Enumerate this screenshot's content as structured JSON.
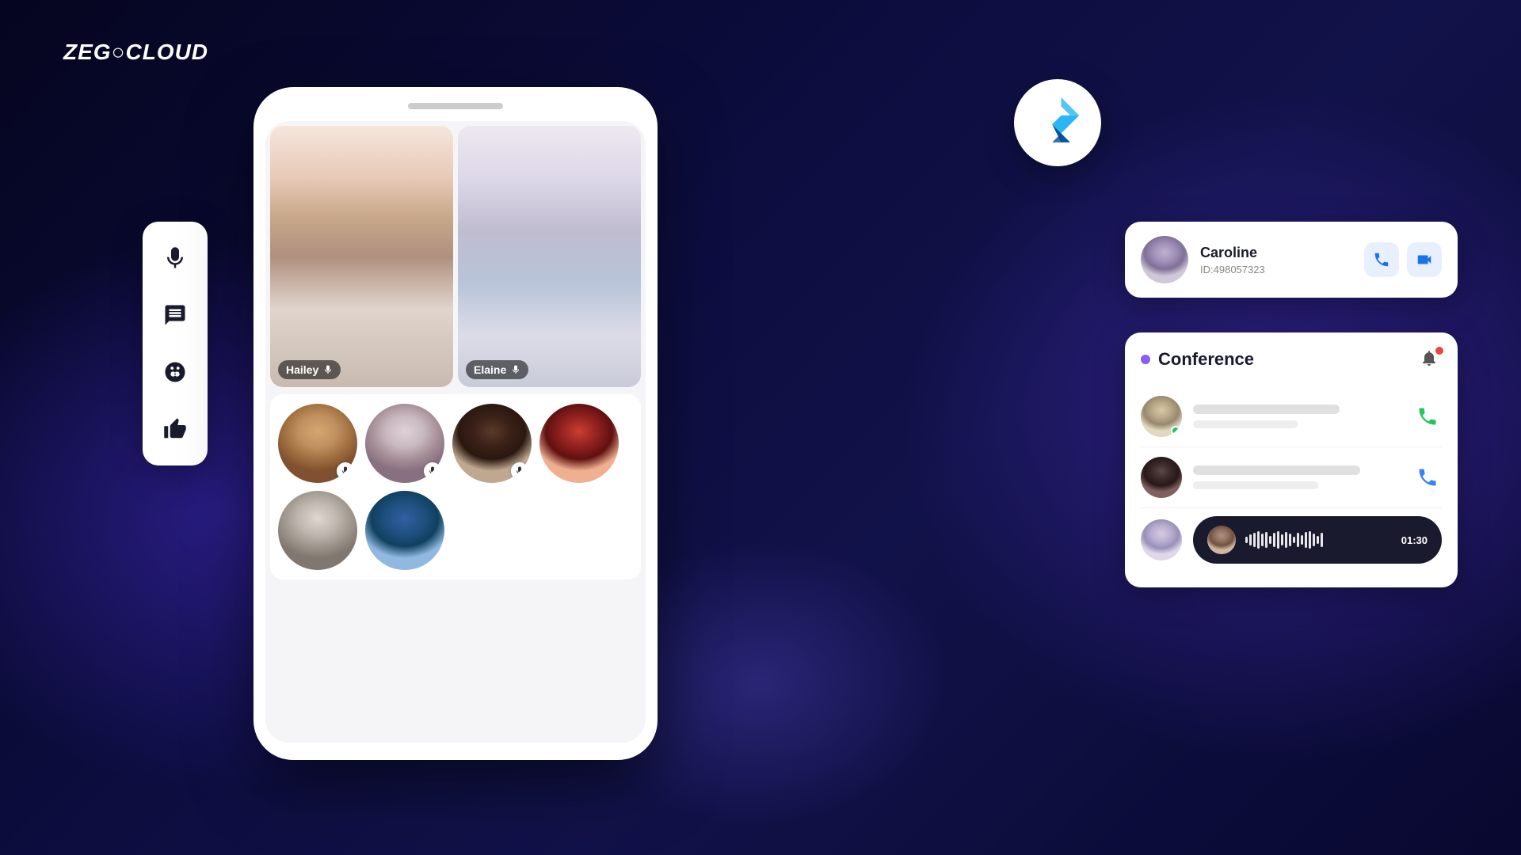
{
  "brand": {
    "logo_text": "ZEGOCLOUD"
  },
  "sidebar": {
    "icons": [
      {
        "name": "mic-icon",
        "symbol": "🎤"
      },
      {
        "name": "message-icon",
        "symbol": "💬"
      },
      {
        "name": "emoji-icon",
        "symbol": "😊"
      },
      {
        "name": "thumbs-up-icon",
        "symbol": "👍"
      }
    ]
  },
  "video_call": {
    "participant_1": {
      "name": "Hailey",
      "mic": true
    },
    "participant_2": {
      "name": "Elaine",
      "mic": true
    }
  },
  "contact_card": {
    "name": "Caroline",
    "id_label": "ID:",
    "id": "498057323"
  },
  "conference": {
    "title": "Conference",
    "items": [
      {
        "has_online": true
      },
      {
        "has_online": false
      },
      {}
    ]
  },
  "voice_message": {
    "duration": "01:30"
  }
}
